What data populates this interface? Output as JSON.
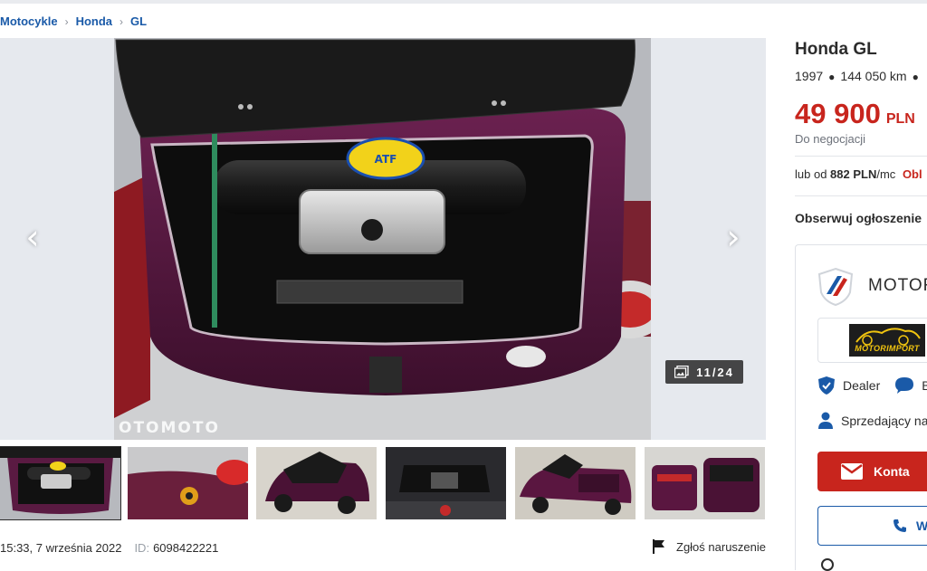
{
  "breadcrumb": {
    "items": [
      "Motocykle",
      "Honda",
      "GL"
    ]
  },
  "gallery": {
    "counter": "11/24",
    "watermark": "OTOMOTO",
    "prev_icon": "chevron-left-icon",
    "next_icon": "chevron-right-icon"
  },
  "meta": {
    "date": "15:33, 7 września 2022",
    "id_label": "ID:",
    "id_value": "6098422221",
    "report_label": "Zgłoś naruszenie"
  },
  "listing": {
    "title": "Honda GL",
    "year": "1997",
    "mileage": "144 050 km",
    "price": "49 900",
    "currency": "PLN",
    "negotiable": "Do negocjacji",
    "finance_prefix": "lub od",
    "finance_amount": "882 PLN",
    "finance_suffix": "/mc",
    "finance_link": "Obl",
    "follow": "Obserwuj ogłoszenie"
  },
  "dealer": {
    "name": "MOTOR",
    "logo_text": "MOTORIMPORT",
    "tag_dealer": "Dealer",
    "tag_second": "B",
    "seller_label": "Sprzedający na",
    "contact_button": "Konta",
    "phone_button": "W"
  },
  "colors": {
    "link_blue": "#1a5aa8",
    "price_red": "#c8251d",
    "gallery_bg": "#e6e9ee"
  }
}
